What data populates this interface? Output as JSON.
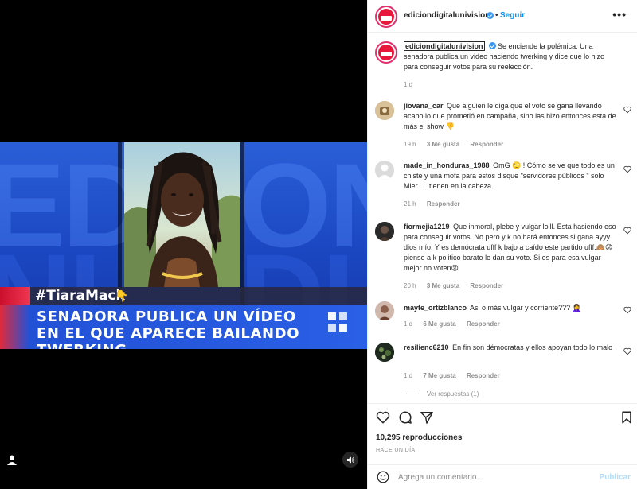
{
  "post": {
    "author": "ediciondigitalunivision",
    "follow_label": "Seguir",
    "separator": "•",
    "more_label": "•••"
  },
  "video": {
    "hashtag": "#TiaraMack",
    "headline": "SENADORA PUBLICA UN VÍDEO EN EL QUE APARECE BAILANDO TWERKING",
    "hand_emoji": "👇",
    "accent_color": "#2a60e6",
    "red_color": "#e12a3b"
  },
  "caption": {
    "username": "ediciondigitalunivision",
    "text": "Se enciende la polémica: Una senadora publica un video haciendo twerking y dice que lo hizo para conseguir votos para su reelección.",
    "time": "1 d"
  },
  "comments": [
    {
      "username": "jiovana_car",
      "text": "Que alguien le diga que el voto se gana llevando acabo lo que prometió en campaña, sino las hizo entonces esta de más el show 👎",
      "time": "19 h",
      "likes": "3 Me gusta",
      "reply": "Responder"
    },
    {
      "username": "made_in_honduras_1988",
      "text": "OmG 🙄!! Cómo se ve que todo es un chiste y una mofa para estos disque \"servidores públicos \" solo Mier..... tienen en la cabeza",
      "time": "21 h",
      "likes": "",
      "reply": "Responder"
    },
    {
      "username": "fiormejia1219",
      "text": "Que inmoral, plebe y vulgar lolll. Esta hasiendo eso para conseguir votos. No pero y k no hará entonces si gana ayyy dios mío. Y es demócrata ufff k bajo a caído este partido ufff.🙈😟piense a k politico barato le dan su voto. Si es para esa vulgar mejor no voten😟",
      "time": "20 h",
      "likes": "3 Me gusta",
      "reply": "Responder"
    },
    {
      "username": "mayte_ortizblanco",
      "text": "Asi o más vulgar y corriente??? 🤦‍♀️",
      "time": "1 d",
      "likes": "6 Me gusta",
      "reply": "Responder"
    },
    {
      "username": "resilienc6210",
      "text": "En fin son démocratas y ellos apoyan todo lo malo",
      "time": "1 d",
      "likes": "7 Me gusta",
      "reply": "Responder",
      "view_replies": "Ver respuestas (1)"
    }
  ],
  "stats": {
    "views": "10,295 reproducciones",
    "posted": "HACE UN DÍA"
  },
  "add_comment": {
    "placeholder": "Agrega un comentario...",
    "publish_label": "Publicar"
  }
}
